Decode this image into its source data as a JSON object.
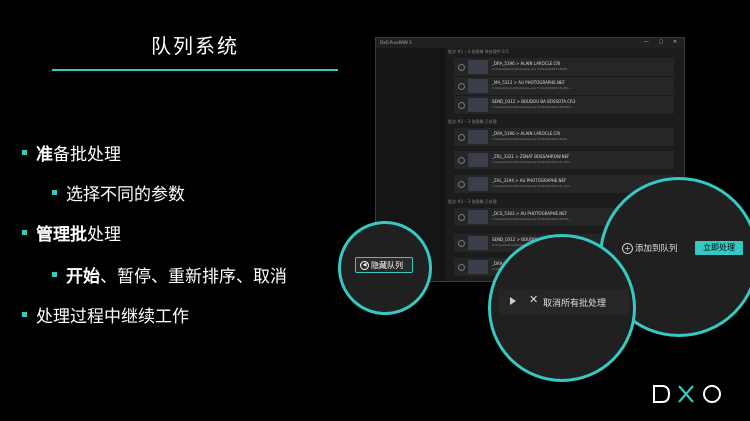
{
  "slide": {
    "title": "队列系统",
    "bullets": [
      {
        "bold": "准",
        "rest": "备批处理"
      },
      {
        "text": "选择不同的参数"
      },
      {
        "bold": "管理批",
        "rest": "处理"
      },
      {
        "bold": "开始",
        "rest": "、暂停、重新排序、取消"
      },
      {
        "text": "处理过程中继续工作"
      }
    ]
  },
  "window": {
    "title": "DxO PureRAW 3",
    "sections": [
      "批次 #1 – 3 张图像 待处理中 2/3",
      "批次 #2 – 3 张图像 已处理",
      "批次 #3 – 3 张图像 已处理"
    ],
    "rows": [
      {
        "name": "_DRA_5196 > ALAIN LAROCLE.CRI",
        "path": "C:\\Users\\Demo\\Pictures\\Lucie Forte\\20220313\\DR...."
      },
      {
        "name": "_MA_5312 > AU PHOTOGRAPHE.NEF",
        "path": "C:\\Users\\Demo\\Pictures\\Lucie Forte\\20220313\\_MA...."
      },
      {
        "name": "SEND_0312 > BOUDOU BA BOSSOTA.CR3",
        "path": "C:\\Users\\Demo\\Pictures\\Lucie Forte\\20220313\\SEND...."
      },
      {
        "name": "_DRA_5196 > ALAIN LAROCLE.CRI",
        "path": "C:\\Users\\Demo\\Pictures\\Lucie Forte\\20220313\\DR...."
      },
      {
        "name": "_ZRL_3321 > ZSNAT BOSSAHROW.NEF",
        "path": "C:\\Users\\Demo\\Pictures\\Lucie Forte\\20220313\\_ZRL...."
      },
      {
        "name": "_ZAL_3194 > AU PHOTOGRAPHE.NEF",
        "path": "C:\\Users\\Demo\\Pictures\\Lucie Forte\\20220313\\_ZAL...."
      },
      {
        "name": "_DCS_5303 > AU PHOTOGRAPHE.NEF",
        "path": "C:\\Users\\Demo\\Pictures\\Lucie Forte\\20220313\\DCS...."
      },
      {
        "name": "SEND_0312 > BOUDOU BA BOSSOTA.CR3",
        "path": "C:\\Users\\Demo\\Pictures\\Lucie Forte\\20220313\\SEND...."
      },
      {
        "name": "_DRA_5301 > ALAIN LAROCLE.CRI",
        "path": "C:\\Users\\Demo\\Pictures\\Lucie Forte\\20220313\\DR...."
      }
    ]
  },
  "callouts": {
    "hide_queue": "隐藏队列",
    "cancel_all": "取消所有批处理",
    "add_to_queue": "添加到队列",
    "process_now": "立即处理"
  },
  "brand": {
    "logo": "DXO"
  },
  "colors": {
    "accent": "#36c9c3",
    "background": "#000000"
  }
}
